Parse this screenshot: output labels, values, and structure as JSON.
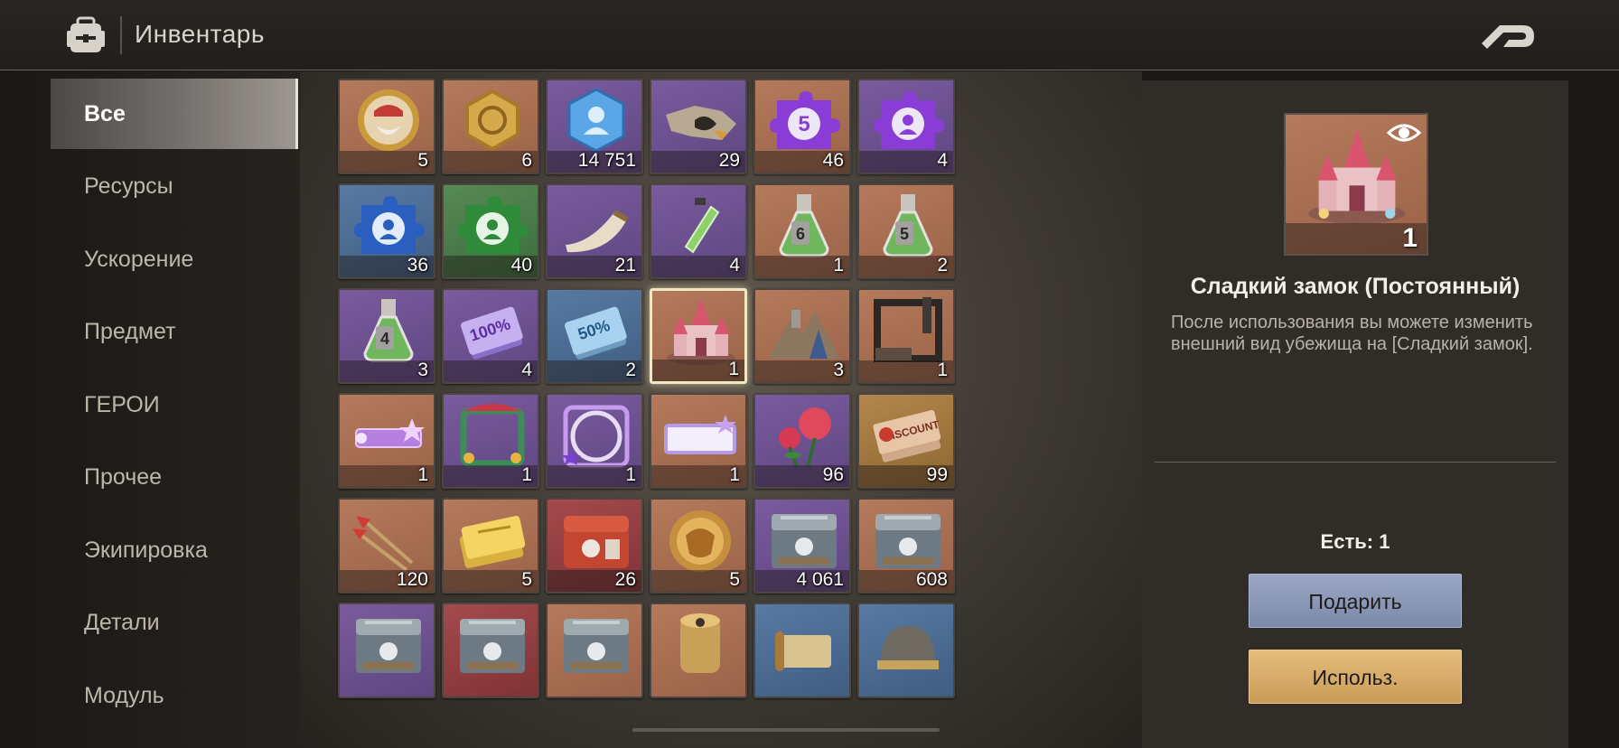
{
  "header": {
    "title": "Инвентарь",
    "bag_icon": "backpack-icon",
    "back_icon": "back-arrow-icon"
  },
  "sidebar": {
    "items": [
      {
        "label": "Все",
        "active": true
      },
      {
        "label": "Ресурсы"
      },
      {
        "label": "Ускорение"
      },
      {
        "label": "Предмет"
      },
      {
        "label": "ГЕРОИ"
      },
      {
        "label": "Прочее"
      },
      {
        "label": "Экипировка"
      },
      {
        "label": "Детали"
      },
      {
        "label": "Модуль"
      }
    ]
  },
  "grid": {
    "items": [
      {
        "icon": "hero-medal-icon",
        "bg": "orange",
        "qty": "5"
      },
      {
        "icon": "gold-hexagon-coin-icon",
        "bg": "orange",
        "qty": "6"
      },
      {
        "icon": "blue-hero-crystal-icon",
        "bg": "purple",
        "qty": "14 751"
      },
      {
        "icon": "torn-map-fragment-icon",
        "bg": "purple",
        "qty": "29"
      },
      {
        "icon": "purple-puzzle-s-icon",
        "bg": "orange",
        "qty": "46"
      },
      {
        "icon": "purple-puzzle-hero-icon",
        "bg": "purple",
        "qty": "4"
      },
      {
        "icon": "blue-puzzle-hero-icon",
        "bg": "blue",
        "qty": "36"
      },
      {
        "icon": "green-puzzle-hero-icon",
        "bg": "green",
        "qty": "40"
      },
      {
        "icon": "horn-icon",
        "bg": "purple",
        "qty": "21"
      },
      {
        "icon": "green-vial-icon",
        "bg": "purple",
        "qty": "4"
      },
      {
        "icon": "flask-6-icon",
        "bg": "orange",
        "qty": "1"
      },
      {
        "icon": "flask-5-icon",
        "bg": "orange",
        "qty": "2"
      },
      {
        "icon": "flask-4-icon",
        "bg": "purple",
        "qty": "3"
      },
      {
        "icon": "ticket-100-icon",
        "bg": "purple",
        "qty": "4"
      },
      {
        "icon": "ticket-50-icon",
        "bg": "blue",
        "qty": "2"
      },
      {
        "icon": "sweet-castle-icon",
        "bg": "orange",
        "qty": "1",
        "selected": true
      },
      {
        "icon": "mountain-base-icon",
        "bg": "orange",
        "qty": "3"
      },
      {
        "icon": "industrial-frame-icon",
        "bg": "orange",
        "qty": "1"
      },
      {
        "icon": "star-nameplate-icon",
        "bg": "orange",
        "qty": "1"
      },
      {
        "icon": "jester-frame-icon",
        "bg": "purple",
        "qty": "1"
      },
      {
        "icon": "star-ring-frame-icon",
        "bg": "purple",
        "qty": "1"
      },
      {
        "icon": "purple-nameplate-icon",
        "bg": "orange",
        "qty": "1"
      },
      {
        "icon": "rose-icon",
        "bg": "purple",
        "qty": "96"
      },
      {
        "icon": "discount-ticket-icon",
        "bg": "gold",
        "qty": "99"
      },
      {
        "icon": "darts-icon",
        "bg": "orange",
        "qty": "120"
      },
      {
        "icon": "gold-ticket-icon",
        "bg": "orange",
        "qty": "5"
      },
      {
        "icon": "red-chest-icon",
        "bg": "red",
        "qty": "26"
      },
      {
        "icon": "lion-coin-icon",
        "bg": "orange",
        "qty": "5"
      },
      {
        "icon": "steel-chest-icon",
        "bg": "purple",
        "qty": "4 061"
      },
      {
        "icon": "steel-chest-icon",
        "bg": "orange",
        "qty": "608"
      },
      {
        "icon": "steel-chest-icon",
        "bg": "purple",
        "qty": ""
      },
      {
        "icon": "steel-chest-icon",
        "bg": "red",
        "qty": ""
      },
      {
        "icon": "steel-chest-icon",
        "bg": "orange",
        "qty": ""
      },
      {
        "icon": "gold-can-icon",
        "bg": "orange",
        "qty": ""
      },
      {
        "icon": "scroll-item-icon",
        "bg": "blue",
        "qty": ""
      },
      {
        "icon": "helmet-icon",
        "bg": "blue",
        "qty": ""
      }
    ]
  },
  "detail": {
    "preview_icon": "sweet-castle-icon",
    "preview_qty": "1",
    "eye_icon": "eye-icon",
    "name": "Сладкий замок (Постоянный)",
    "description": "После использования вы можете изменить внешний вид убежища на [Сладкий замок].",
    "owned": "Есть: 1",
    "gift_label": "Подарить",
    "use_label": "Использ."
  },
  "colors": {
    "orange_tile": "#a56c50",
    "purple_tile": "#6a4f8f",
    "blue_tile": "#4c6c93",
    "green_tile": "#4a7a48",
    "gift_button": "#8795b6",
    "use_button": "#d8ac6a"
  }
}
